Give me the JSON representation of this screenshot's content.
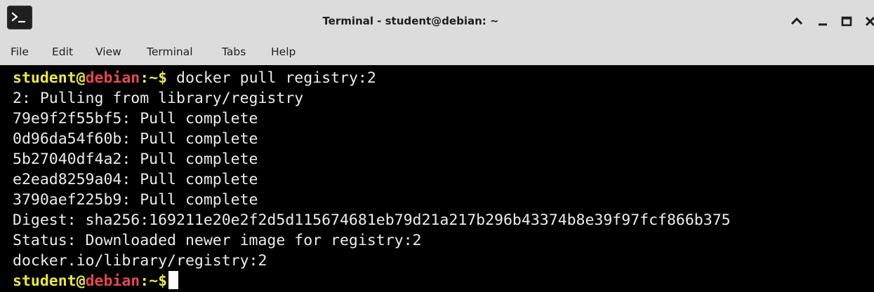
{
  "window": {
    "title": "Terminal - student@debian: ~",
    "icon": "terminal-app-icon",
    "controls": [
      "chevron-up-icon",
      "minimize-icon",
      "maximize-icon",
      "close-icon"
    ]
  },
  "menu": {
    "items": [
      "File",
      "Edit",
      "View",
      "Terminal",
      "Tabs",
      "Help"
    ]
  },
  "prompt": {
    "user": "student",
    "at": "@",
    "host": "debian",
    "sep": ":",
    "path": "~",
    "symbol": "$"
  },
  "terminal": {
    "command": " docker pull registry:2",
    "output": [
      "2: Pulling from library/registry",
      "79e9f2f55bf5: Pull complete",
      "0d96da54f60b: Pull complete",
      "5b27040df4a2: Pull complete",
      "e2ead8259a04: Pull complete",
      "3790aef225b9: Pull complete",
      "Digest: sha256:169211e20e2f2d5d115674681eb79d21a217b296b43374b8e39f97fcf866b375",
      "Status: Downloaded newer image for registry:2",
      "docker.io/library/registry:2"
    ]
  },
  "colors": {
    "titlebar_bg": "#dcdcdc",
    "terminal_bg": "#000000",
    "terminal_fg": "#ececec",
    "prompt_user": "#e8e84a",
    "prompt_host": "#e5484d"
  }
}
